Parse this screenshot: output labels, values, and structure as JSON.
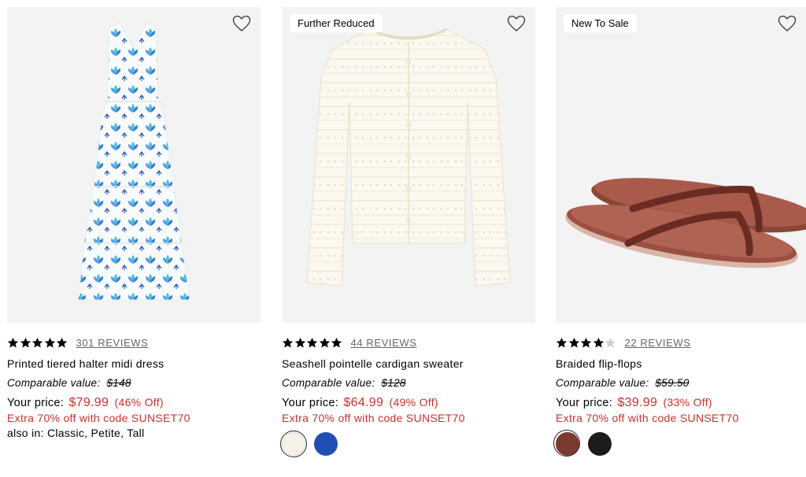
{
  "products": [
    {
      "badge": "",
      "rating": 5,
      "reviews": "301 REVIEWS",
      "name": "Printed tiered halter midi dress",
      "comparable_label": "Comparable value:",
      "comparable_price": "$148",
      "price_label": "Your price:",
      "price": "$79.99",
      "discount": "(46% Off)",
      "promo": "Extra 70% off with code SUNSET70",
      "also_in": "also in: Classic, Petite, Tall",
      "swatches": []
    },
    {
      "badge": "Further Reduced",
      "rating": 5,
      "reviews": "44 REVIEWS",
      "name": "Seashell pointelle cardigan sweater",
      "comparable_label": "Comparable value:",
      "comparable_price": "$128",
      "price_label": "Your price:",
      "price": "$64.99",
      "discount": "(49% Off)",
      "promo": "Extra 70% off with code SUNSET70",
      "also_in": "",
      "swatches": [
        {
          "color": "#f5f1e6",
          "selected": true
        },
        {
          "color": "#1f4fb4",
          "selected": false
        }
      ]
    },
    {
      "badge": "New To Sale",
      "rating": 4,
      "reviews": "22 REVIEWS",
      "name": "Braided flip-flops",
      "comparable_label": "Comparable value:",
      "comparable_price": "$59.50",
      "price_label": "Your price:",
      "price": "$39.99",
      "discount": "(33% Off)",
      "promo": "Extra 70% off with code SUNSET70",
      "also_in": "",
      "swatches": [
        {
          "color": "#7a3a2e",
          "selected": true
        },
        {
          "color": "#1e1c1b",
          "selected": false
        }
      ]
    }
  ],
  "colors": {
    "sale_red": "#c8332b",
    "tile_bg": "#f3f3f3"
  },
  "icons": {
    "wishlist": "heart-outline-icon",
    "rating": "star-icon"
  }
}
